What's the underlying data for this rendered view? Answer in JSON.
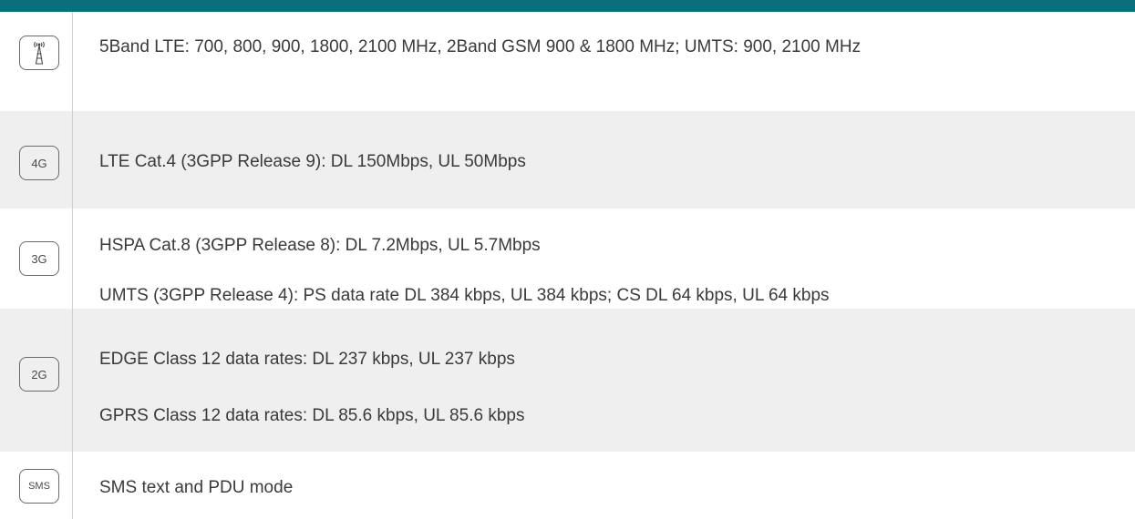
{
  "colors": {
    "header_bar": "#0b6e7a",
    "shaded_row": "#efefef",
    "text": "#3a3a3a",
    "badge_border": "#6a6a6a"
  },
  "rows": [
    {
      "icon": "antenna-tower-icon",
      "badge_text": "",
      "lines": [
        "5Band LTE: 700, 800, 900, 1800, 2100 MHz, 2Band GSM 900 & 1800 MHz; UMTS: 900, 2100 MHz"
      ]
    },
    {
      "icon": "4g-badge",
      "badge_text": "4G",
      "lines": [
        "LTE Cat.4 (3GPP Release 9): DL 150Mbps, UL 50Mbps"
      ]
    },
    {
      "icon": "3g-badge",
      "badge_text": "3G",
      "lines": [
        "HSPA Cat.8 (3GPP Release 8): DL 7.2Mbps, UL 5.7Mbps",
        "UMTS (3GPP Release 4): PS data rate DL 384 kbps, UL 384 kbps; CS DL 64 kbps, UL 64 kbps"
      ]
    },
    {
      "icon": "2g-badge",
      "badge_text": "2G",
      "lines": [
        "EDGE Class 12 data rates: DL 237 kbps, UL 237 kbps",
        "GPRS Class 12 data rates: DL 85.6 kbps, UL 85.6 kbps"
      ]
    },
    {
      "icon": "sms-badge",
      "badge_text": "SMS",
      "lines": [
        "SMS text and PDU mode"
      ]
    }
  ]
}
